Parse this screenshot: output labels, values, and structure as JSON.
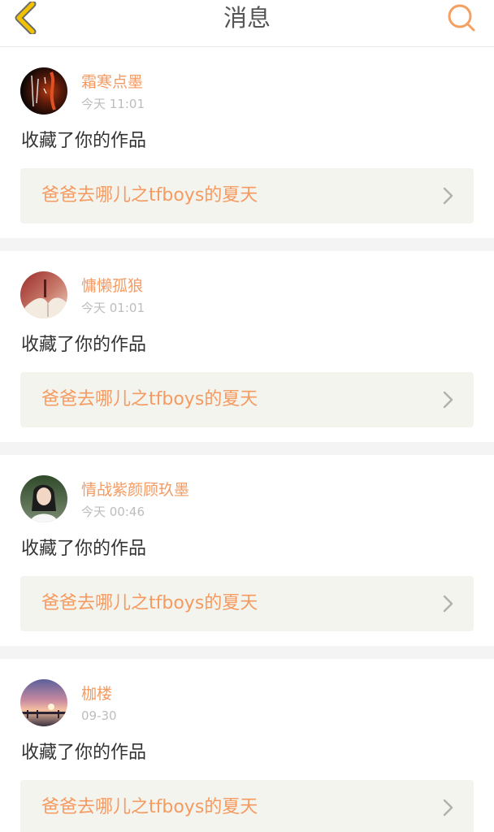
{
  "header": {
    "title": "消息",
    "back_icon": "chevron-left-icon",
    "search_icon": "search-icon",
    "accent_color": "#f2c200",
    "search_color": "#f5a060"
  },
  "feed": {
    "items": [
      {
        "username": "霜寒点墨",
        "time": "今天 11:01",
        "action": "收藏了你的作品",
        "work_title": "爸爸去哪儿之tfboys的夏天",
        "avatar": "avatar-dark-calligraphy"
      },
      {
        "username": "慵懒孤狼",
        "time": "今天 01:01",
        "action": "收藏了你的作品",
        "work_title": "爸爸去哪儿之tfboys的夏天",
        "avatar": "avatar-book-reading"
      },
      {
        "username": "情战紫颜顾玖墨",
        "time": "今天 00:46",
        "action": "收藏了你的作品",
        "work_title": "爸爸去哪儿之tfboys的夏天",
        "avatar": "avatar-woman-portrait"
      },
      {
        "username": "枷楼",
        "time": "09-30",
        "action": "收藏了你的作品",
        "work_title": "爸爸去哪儿之tfboys的夏天",
        "avatar": "avatar-sunset-bridge"
      }
    ]
  },
  "colors": {
    "username": "#f59a61",
    "time": "#bdbdbd",
    "link_bg": "#f4f4ee",
    "separator": "#f4f4f4"
  }
}
